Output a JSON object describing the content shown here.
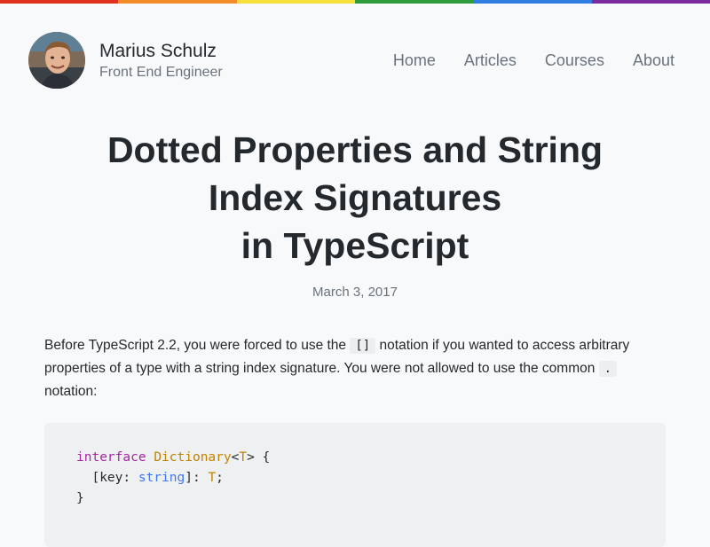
{
  "header": {
    "name": "Marius Schulz",
    "tagline": "Front End Engineer",
    "nav": [
      {
        "label": "Home"
      },
      {
        "label": "Articles"
      },
      {
        "label": "Courses"
      },
      {
        "label": "About"
      }
    ]
  },
  "rainbow_colors": [
    "#e0301e",
    "#f28c28",
    "#f7e03c",
    "#2e9c3a",
    "#2f7de1",
    "#7a2a9c"
  ],
  "article": {
    "title_lines": [
      "Dotted Properties and String",
      "Index Signatures",
      "in TypeScript"
    ],
    "date": "March 3, 2017",
    "paragraph": {
      "t1": "Before TypeScript 2.2, you were forced to use the ",
      "c1": "[]",
      "t2": " notation if you wanted to access arbitrary properties of a type with a string index signature. You were not allowed to use the common ",
      "c2": ".",
      "t3": " notation:"
    },
    "code": {
      "l1_kw": "interface",
      "l1_name": "Dictionary",
      "l1_open": "<",
      "l1_tp": "T",
      "l1_close": "> {",
      "l2_indent": "  [key: ",
      "l2_type": "string",
      "l2_mid": "]: ",
      "l2_tp": "T",
      "l2_end": ";",
      "l3": "}"
    }
  }
}
